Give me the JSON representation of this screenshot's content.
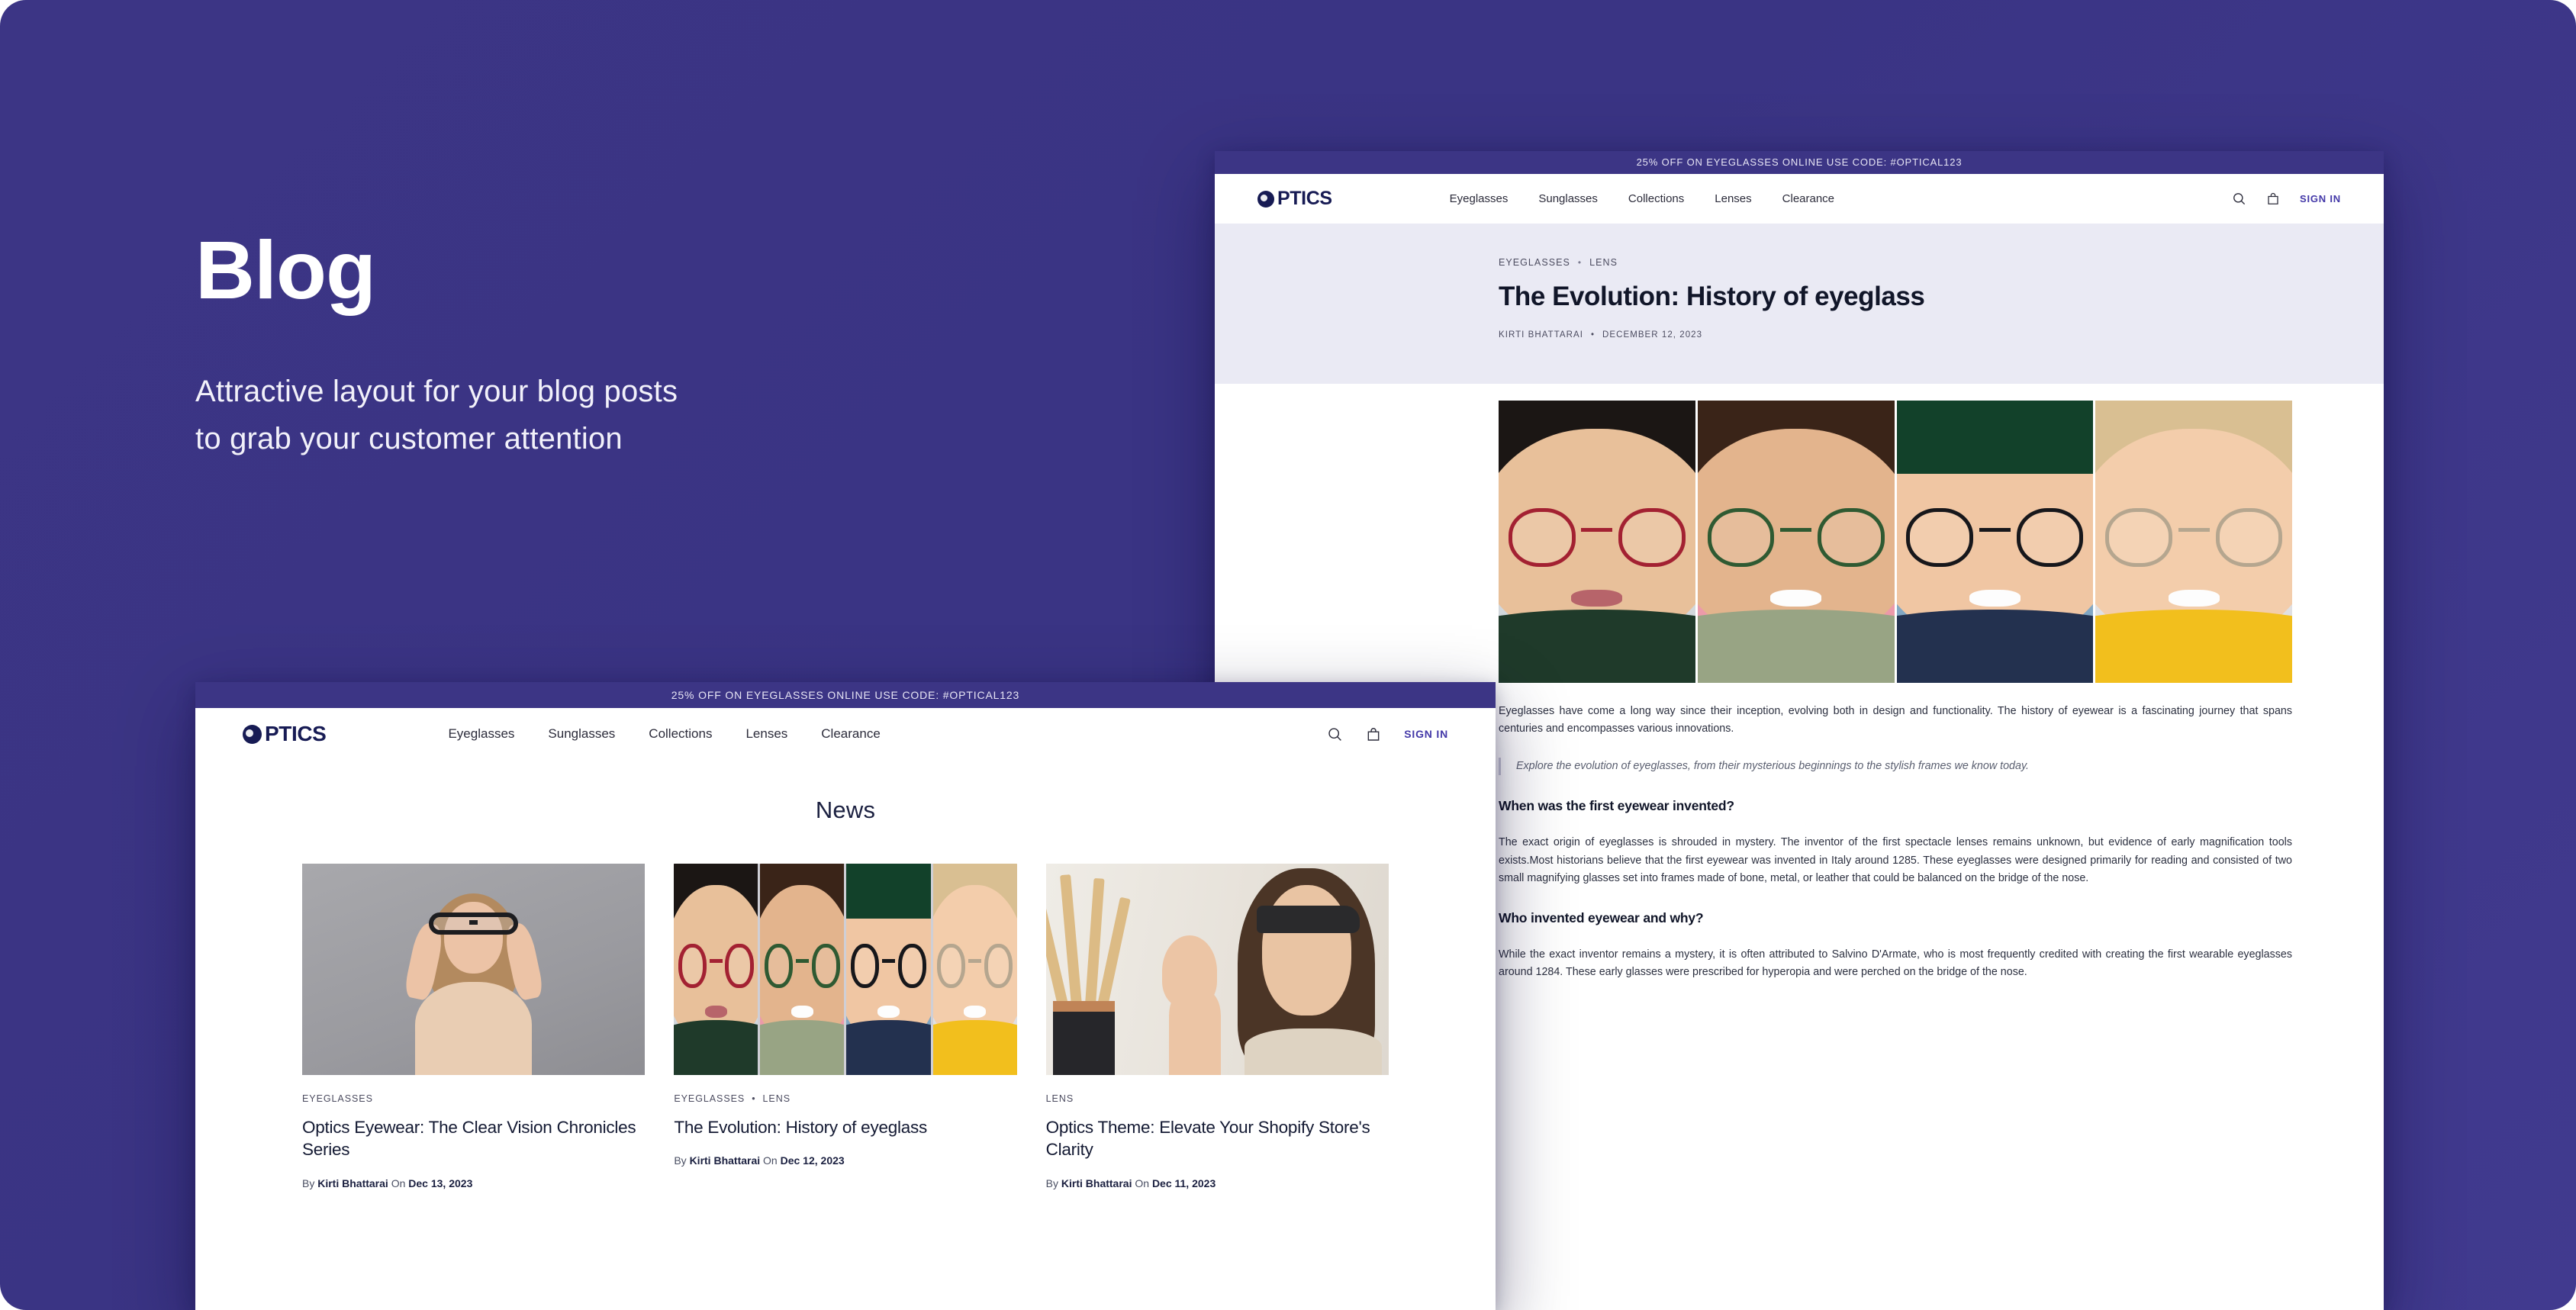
{
  "hero": {
    "title": "Blog",
    "subtitle_line1": "Attractive layout for your blog posts",
    "subtitle_line2": "to grab your customer attention"
  },
  "colors": {
    "backdrop": "#3c3585",
    "brand_navy": "#171b54",
    "accent_link": "#4338a8",
    "article_band": "#eaeaf4"
  },
  "store": {
    "announcement": "25% OFF ON EYEGLASSES ONLINE USE CODE: #OPTICAL123",
    "brand_mark": "optics-globe-logo",
    "brand_name": "PTICS",
    "nav": [
      {
        "label": "Eyeglasses"
      },
      {
        "label": "Sunglasses"
      },
      {
        "label": "Collections"
      },
      {
        "label": "Lenses"
      },
      {
        "label": "Clearance"
      }
    ],
    "actions": {
      "search_icon": "search-icon",
      "cart_icon": "shopping-bag-icon",
      "signin_label": "SIGN IN"
    }
  },
  "article_window": {
    "categories": [
      "EYEGLASSES",
      "LENS"
    ],
    "separator": "•",
    "title": "The Evolution: History of eyeglass",
    "author": "KIRTI BHATTARAI",
    "date": "DECEMBER 12, 2023",
    "hero_image_alt": "four-people-wearing-eyeglasses-photo-strip",
    "intro": "Eyeglasses have come a long way since their inception, evolving both in design and functionality. The history of eyewear is a fascinating journey that spans centuries and encompasses various innovations.",
    "pullquote": "Explore the evolution of eyeglasses, from their mysterious beginnings to the stylish frames we know today.",
    "section1_heading": "When was the first eyewear invented?",
    "section1_body": "The exact origin of eyeglasses is shrouded in mystery. The inventor of the first spectacle lenses remains unknown, but evidence of early magnification tools exists.Most historians believe that the first eyewear was invented in Italy around 1285. These eyeglasses were designed primarily for reading and consisted of two small magnifying glasses set into frames made of bone, metal, or leather that could be balanced on the bridge of the nose.",
    "section2_heading": "Who invented eyewear and why?",
    "section2_body": "While the exact inventor remains a mystery, it is often attributed to Salvino D'Armate, who is most frequently credited with creating the first wearable eyeglasses around 1284. These early glasses were prescribed for hyperopia and were perched on the bridge of the nose."
  },
  "blog_window": {
    "page_heading": "News",
    "cards": [
      {
        "image_alt": "woman-holding-black-eyeglasses-grey-background",
        "categories": [
          "EYEGLASSES"
        ],
        "title": "Optics Eyewear: The Clear Vision Chronicles Series",
        "by_label": "By",
        "author": "Kirti Bhattarai",
        "on_label": "On",
        "date": "Dec 13, 2023"
      },
      {
        "image_alt": "four-people-wearing-eyeglasses-photo-strip",
        "categories": [
          "EYEGLASSES",
          "LENS"
        ],
        "title": "The Evolution: History of eyeglass",
        "by_label": "By",
        "author": "Kirti Bhattarai",
        "on_label": "On",
        "date": "Dec 12, 2023"
      },
      {
        "image_alt": "woman-wearing-black-sunglasses-indoor",
        "categories": [
          "LENS"
        ],
        "title": "Optics Theme: Elevate Your Shopify Store's Clarity",
        "by_label": "By",
        "author": "Kirti Bhattarai",
        "on_label": "On",
        "date": "Dec 11, 2023"
      }
    ],
    "card_separator": "•"
  }
}
